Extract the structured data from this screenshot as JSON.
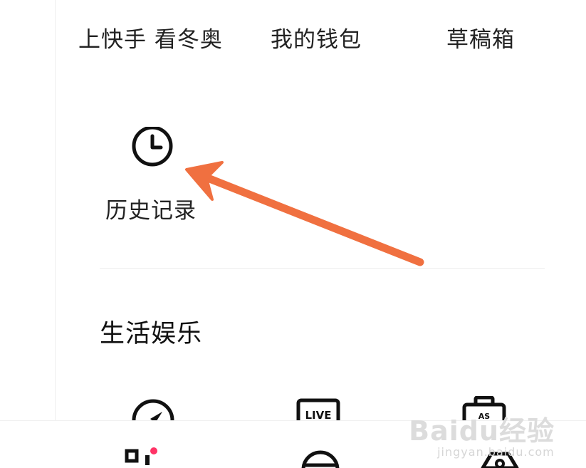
{
  "top_row": {
    "items": [
      {
        "label": "上快手 看冬奥"
      },
      {
        "label": "我的钱包"
      },
      {
        "label": "草稿箱"
      }
    ]
  },
  "history": {
    "icon": "clock-icon",
    "label": "历史记录"
  },
  "annotation": {
    "arrow_color": "#f07040"
  },
  "section": {
    "title": "生活娱乐",
    "icons": [
      "compass-icon",
      "live-icon",
      "briefcase-icon"
    ]
  },
  "bottom_nav": {
    "icons": [
      "scan-icon",
      "circle-icon",
      "hexagon-icon"
    ],
    "badge_color": "#ff3366"
  },
  "watermark": {
    "brand": "Baidu经验",
    "url": "jingyan.baidu.com"
  }
}
